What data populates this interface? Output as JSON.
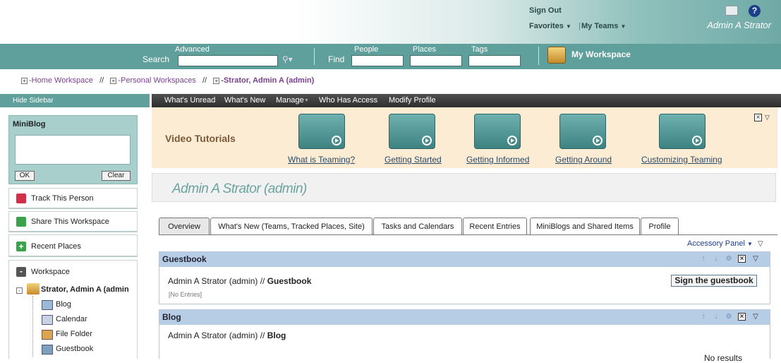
{
  "header": {
    "sign_out": "Sign Out",
    "favorites": "Favorites",
    "my_teams": "My Teams",
    "user_name": "Admin A Strator",
    "help_glyph": "?"
  },
  "search": {
    "advanced_label": "Advanced",
    "search_label": "Search",
    "find_label": "Find",
    "people_label": "People",
    "places_label": "Places",
    "tags_label": "Tags",
    "my_workspace": "My Workspace"
  },
  "breadcrumb": {
    "items": [
      "-Home Workspace",
      "-Personal Workspaces",
      "-Strator, Admin A (admin)"
    ],
    "separator": "//"
  },
  "sidebar": {
    "hide_label": "Hide Sidebar",
    "miniblog_title": "MiniBlog",
    "ok_label": "OK",
    "clear_label": "Clear",
    "track_label": "Track This Person",
    "share_label": "Share This Workspace",
    "recent_label": "Recent Places",
    "workspace_label": "Workspace",
    "tree_root": "Strator, Admin A (admin",
    "tree_items": [
      "Blog",
      "Calendar",
      "File Folder",
      "Guestbook"
    ]
  },
  "menu": [
    "What's Unread",
    "What's New",
    "Manage",
    "Who Has Access",
    "Modify Profile"
  ],
  "tutorials": {
    "title": "Video Tutorials",
    "items": [
      "What is Teaming?",
      "Getting Started",
      "Getting Informed",
      "Getting Around",
      "Customizing Teaming"
    ]
  },
  "page": {
    "title": "Admin A Strator (admin)",
    "tabs": [
      "Overview",
      "What's New (Teams, Tracked Places, Site)",
      "Tasks and Calendars",
      "Recent Entries",
      "MiniBlogs and Shared Items",
      "Profile"
    ],
    "accessory_panel": "Accessory Panel"
  },
  "guestbook": {
    "header": "Guestbook",
    "path_prefix": "Admin A Strator (admin) // ",
    "path_name": "Guestbook",
    "no_entries": "[No Entries]",
    "sign_button": "Sign the guestbook"
  },
  "blog": {
    "header": "Blog",
    "path_prefix": "Admin A Strator (admin) // ",
    "path_name": "Blog",
    "no_results": "No results"
  },
  "colors": {
    "teal": "#5f9f9c",
    "section_header": "#b7cde6",
    "tutorial_bg": "#fcecd3"
  }
}
